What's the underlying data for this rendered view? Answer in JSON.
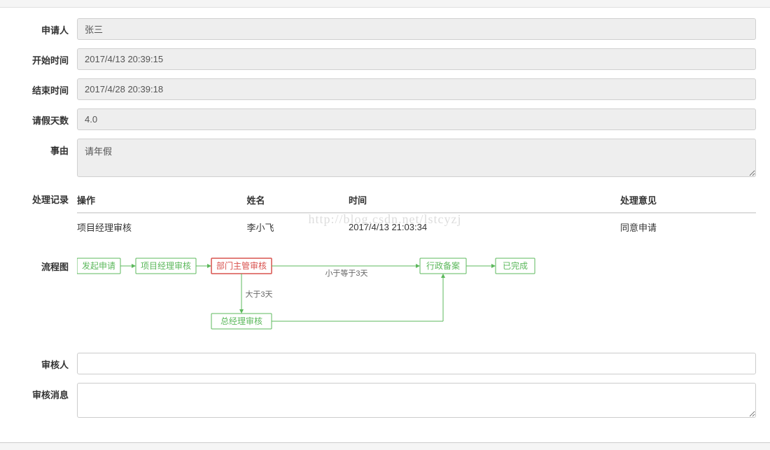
{
  "labels": {
    "applicant": "申请人",
    "startTime": "开始时间",
    "endTime": "结束时间",
    "days": "请假天数",
    "reason": "事由",
    "records": "处理记录",
    "flow": "流程图",
    "reviewer": "审核人",
    "reviewMsg": "审核消息"
  },
  "form": {
    "applicant": "张三",
    "startTime": "2017/4/13 20:39:15",
    "endTime": "2017/4/28 20:39:18",
    "days": "4.0",
    "reason": "请年假",
    "reviewer": "",
    "reviewMsg": ""
  },
  "records": {
    "headers": {
      "action": "操作",
      "name": "姓名",
      "time": "时间",
      "opinion": "处理意见"
    },
    "rows": [
      {
        "action": "项目经理审核",
        "name": "李小飞",
        "time": "2017/4/13 21:03:34",
        "opinion": "同意申请"
      }
    ]
  },
  "flow": {
    "nodes": {
      "start": "发起申请",
      "pm": "项目经理审核",
      "dept": "部门主管审核",
      "gm": "总经理审核",
      "admin": "行政备案",
      "done": "已完成"
    },
    "edges": {
      "lte3": "小于等于3天",
      "gt3": "大于3天"
    }
  },
  "watermark": "http://blog.csdn.net/lstcyzj"
}
